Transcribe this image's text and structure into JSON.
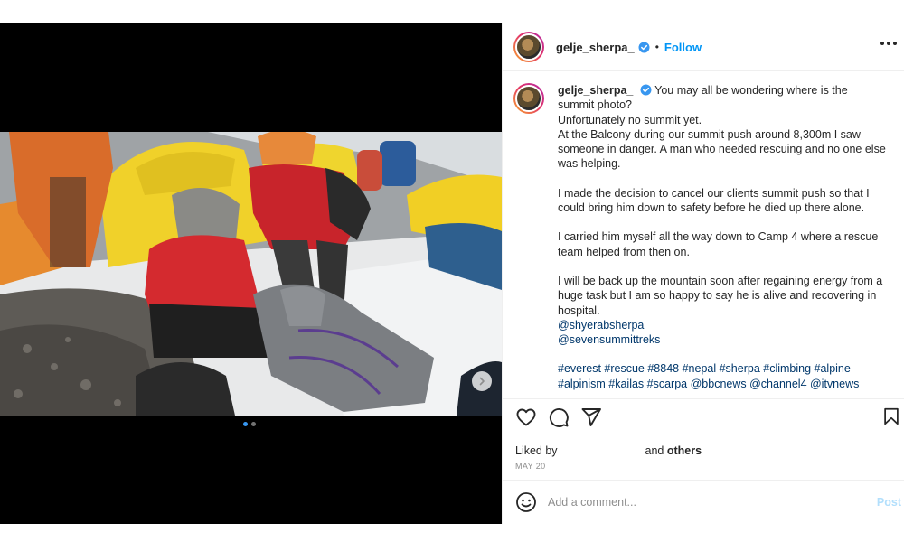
{
  "post": {
    "author": "gelje_sherpa_",
    "follow_label": "Follow",
    "separator": "•",
    "caption": {
      "username": "gelje_sherpa_",
      "lines": [
        "You may all be wondering where is the summit photo?",
        "Unfortunately no summit yet.",
        "At the Balcony during our summit push around 8,300m I saw someone in danger. A man who needed rescuing and no one else was helping.",
        "I made the decision to cancel our clients summit push so that I could bring him down to safety before he died up there alone.",
        "I carried him myself all the way down to Camp 4 where a rescue team helped from then on.",
        "I will be back up the mountain soon after regaining energy from a huge task but I am so happy to say he is alive and recovering in hospital."
      ],
      "mentions": [
        "@shyerabsherpa",
        "@sevensummittreks"
      ],
      "hashtags": "#everest #rescue #8848 #nepal #sherpa #climbing #alpine #alpinism #kailas #scarpa @bbcnews @channel4 @itvnews"
    },
    "likes": {
      "prefix": "Liked by",
      "suffix": "and",
      "others": "others"
    },
    "date": "MAY 20",
    "comment": {
      "placeholder": "Add a comment...",
      "post_label": "Post"
    },
    "media": {
      "slides": 2,
      "active_slide": 1
    },
    "icons": {
      "like": "heart-icon",
      "comment": "comment-icon",
      "share": "share-icon",
      "save": "bookmark-icon",
      "more": "more-options-icon",
      "next": "chevron-right-icon",
      "mute": "mute-icon",
      "emoji": "emoji-icon",
      "verified": "verified-badge-icon"
    },
    "colors": {
      "accent": "#0095f6",
      "verified": "#3897f0",
      "link": "#00376b",
      "muted": "#8e8e8e",
      "post_disabled": "#b2dffc"
    }
  }
}
